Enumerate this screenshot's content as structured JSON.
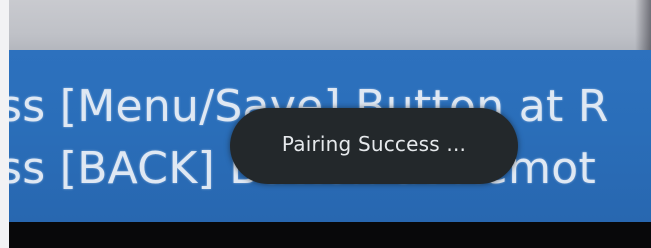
{
  "instructions": {
    "line_1": "ss [Menu/Save] Button at R",
    "line_2": "ss [BACK] Button at Remot"
  },
  "toast": {
    "message": "Pairing Success ..."
  },
  "colors": {
    "panel_blue": "#2a6eb9",
    "toast_background": "#23282b",
    "text_light": "#dfe8f3"
  }
}
